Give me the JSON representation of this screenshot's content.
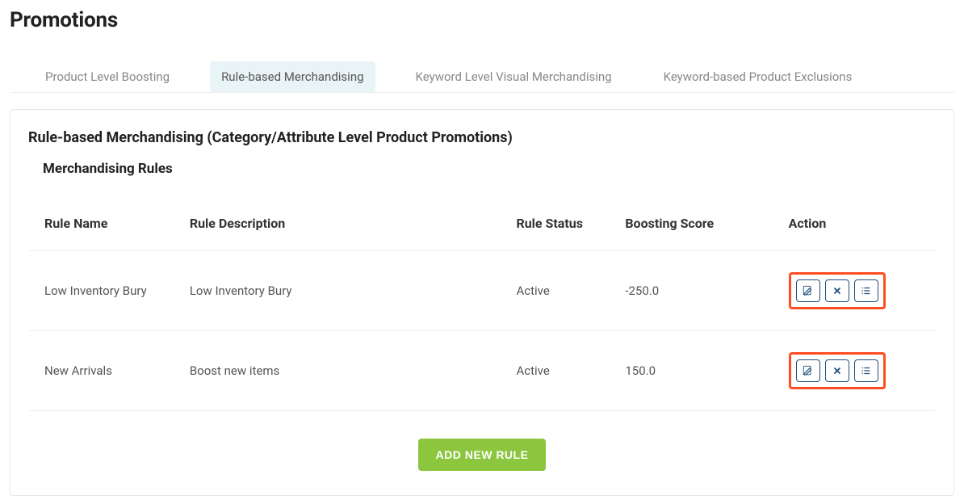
{
  "header": {
    "title": "Promotions"
  },
  "tabs": [
    {
      "label": "Product Level Boosting",
      "active": false
    },
    {
      "label": "Rule-based Merchandising",
      "active": true
    },
    {
      "label": "Keyword Level Visual Merchandising",
      "active": false
    },
    {
      "label": "Keyword-based Product Exclusions",
      "active": false
    }
  ],
  "panel": {
    "title": "Rule-based Merchandising (Category/Attribute Level Product Promotions)",
    "subtitle": "Merchandising Rules",
    "columns": {
      "name": "Rule Name",
      "desc": "Rule Description",
      "status": "Rule Status",
      "score": "Boosting Score",
      "action": "Action"
    },
    "rows": [
      {
        "name": "Low Inventory Bury",
        "desc": "Low Inventory Bury",
        "status": "Active",
        "score": "-250.0"
      },
      {
        "name": "New Arrivals",
        "desc": "Boost new items",
        "status": "Active",
        "score": "150.0"
      }
    ],
    "add_button": "ADD NEW RULE"
  }
}
